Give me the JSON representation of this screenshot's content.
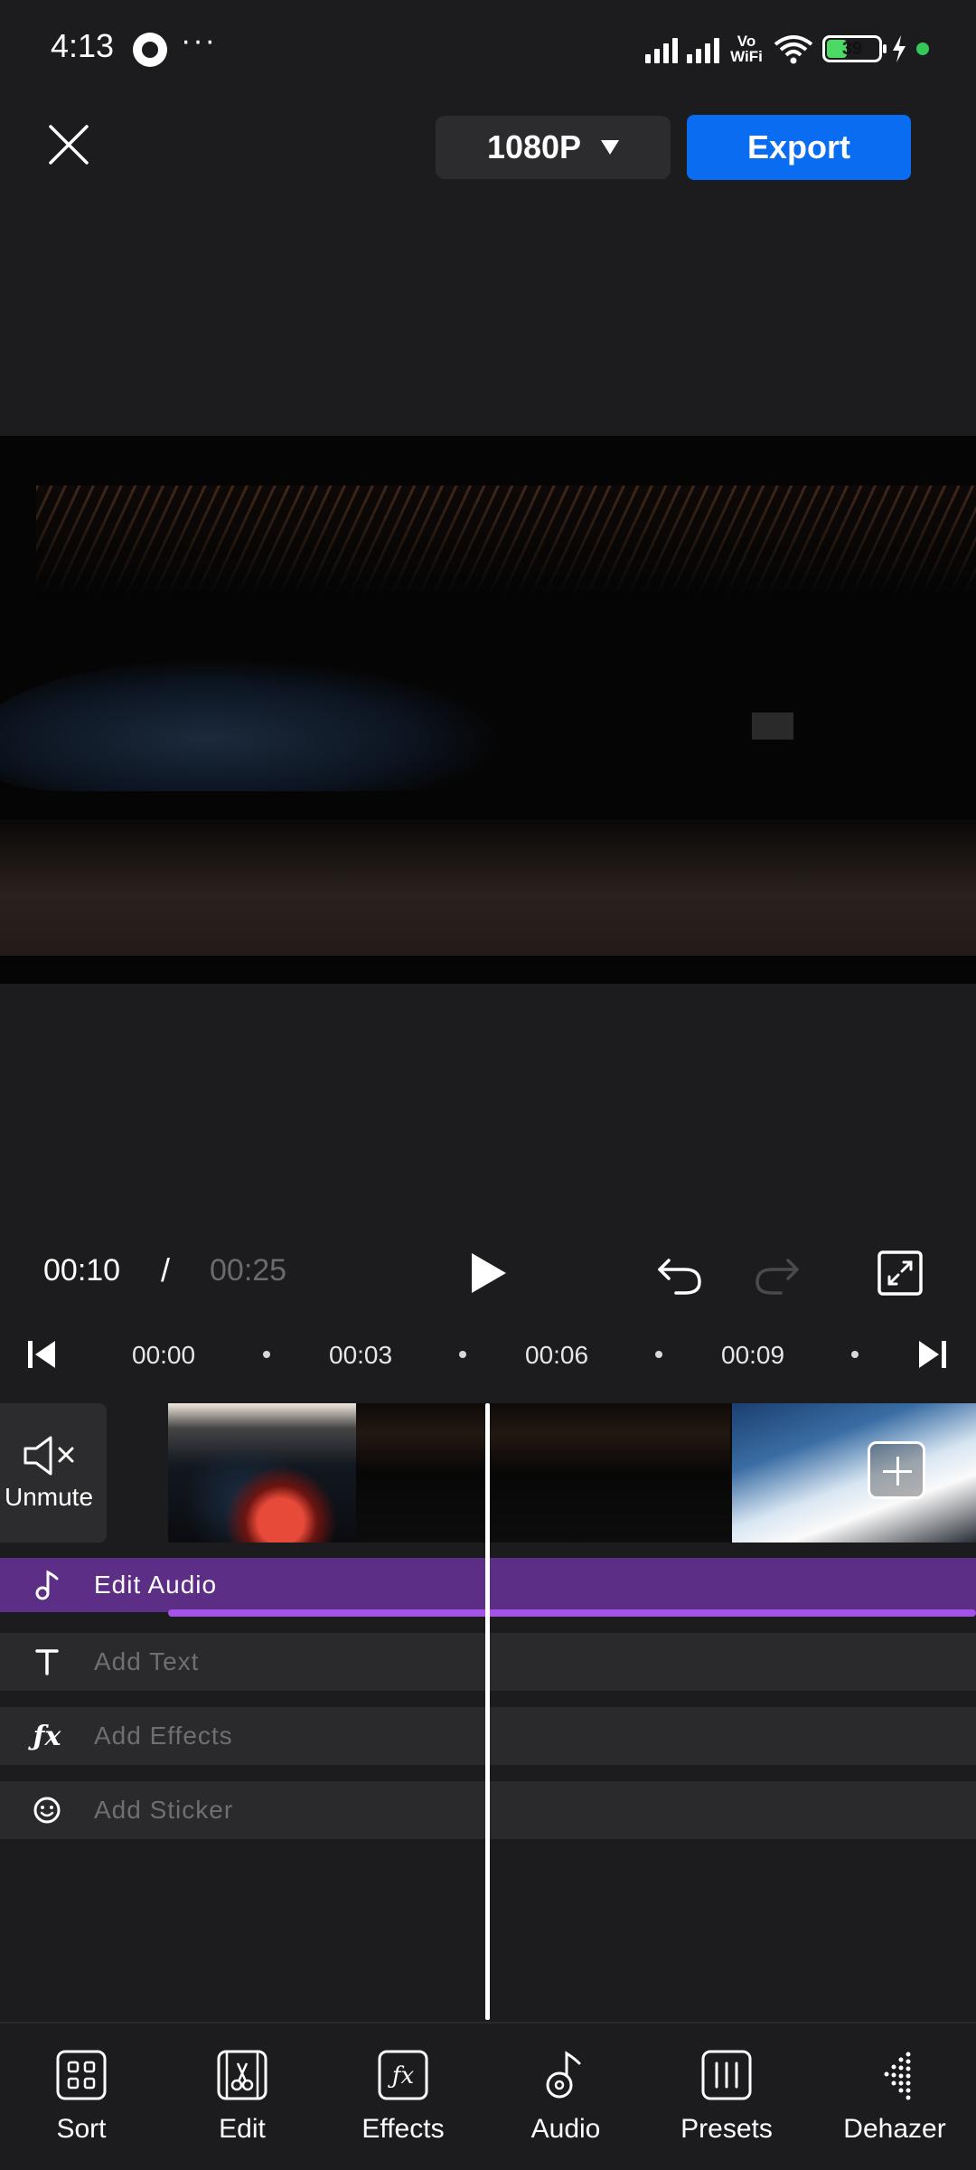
{
  "status_bar": {
    "time": "4:13",
    "dots": "···",
    "network_label_top": "Vo",
    "network_label_bottom": "WiFi",
    "battery_level": "39",
    "battery_fraction": 0.39
  },
  "top_bar": {
    "resolution": "1080P",
    "export_label": "Export"
  },
  "playback": {
    "current_time": "00:10",
    "separator": "/",
    "total_time": "00:25"
  },
  "timeline": {
    "ticks": [
      "00:00",
      "00:03",
      "00:06",
      "00:09"
    ],
    "unmute_label": "Unmute"
  },
  "tracks": {
    "audio": "Edit Audio",
    "text": "Add Text",
    "effects": "Add Effects",
    "sticker": "Add Sticker"
  },
  "toolbar": [
    {
      "label": "Sort",
      "icon": "grid-icon"
    },
    {
      "label": "Edit",
      "icon": "scissors-film-icon"
    },
    {
      "label": "Effects",
      "icon": "fx-icon"
    },
    {
      "label": "Audio",
      "icon": "music-note-icon"
    },
    {
      "label": "Presets",
      "icon": "presets-icon"
    },
    {
      "label": "Dehazer",
      "icon": "dehazer-icon"
    }
  ],
  "colors": {
    "background": "#1c1c1e",
    "accent": "#0a6cf0",
    "audio_track": "#5c2e86",
    "audio_bar": "#a453e8"
  }
}
